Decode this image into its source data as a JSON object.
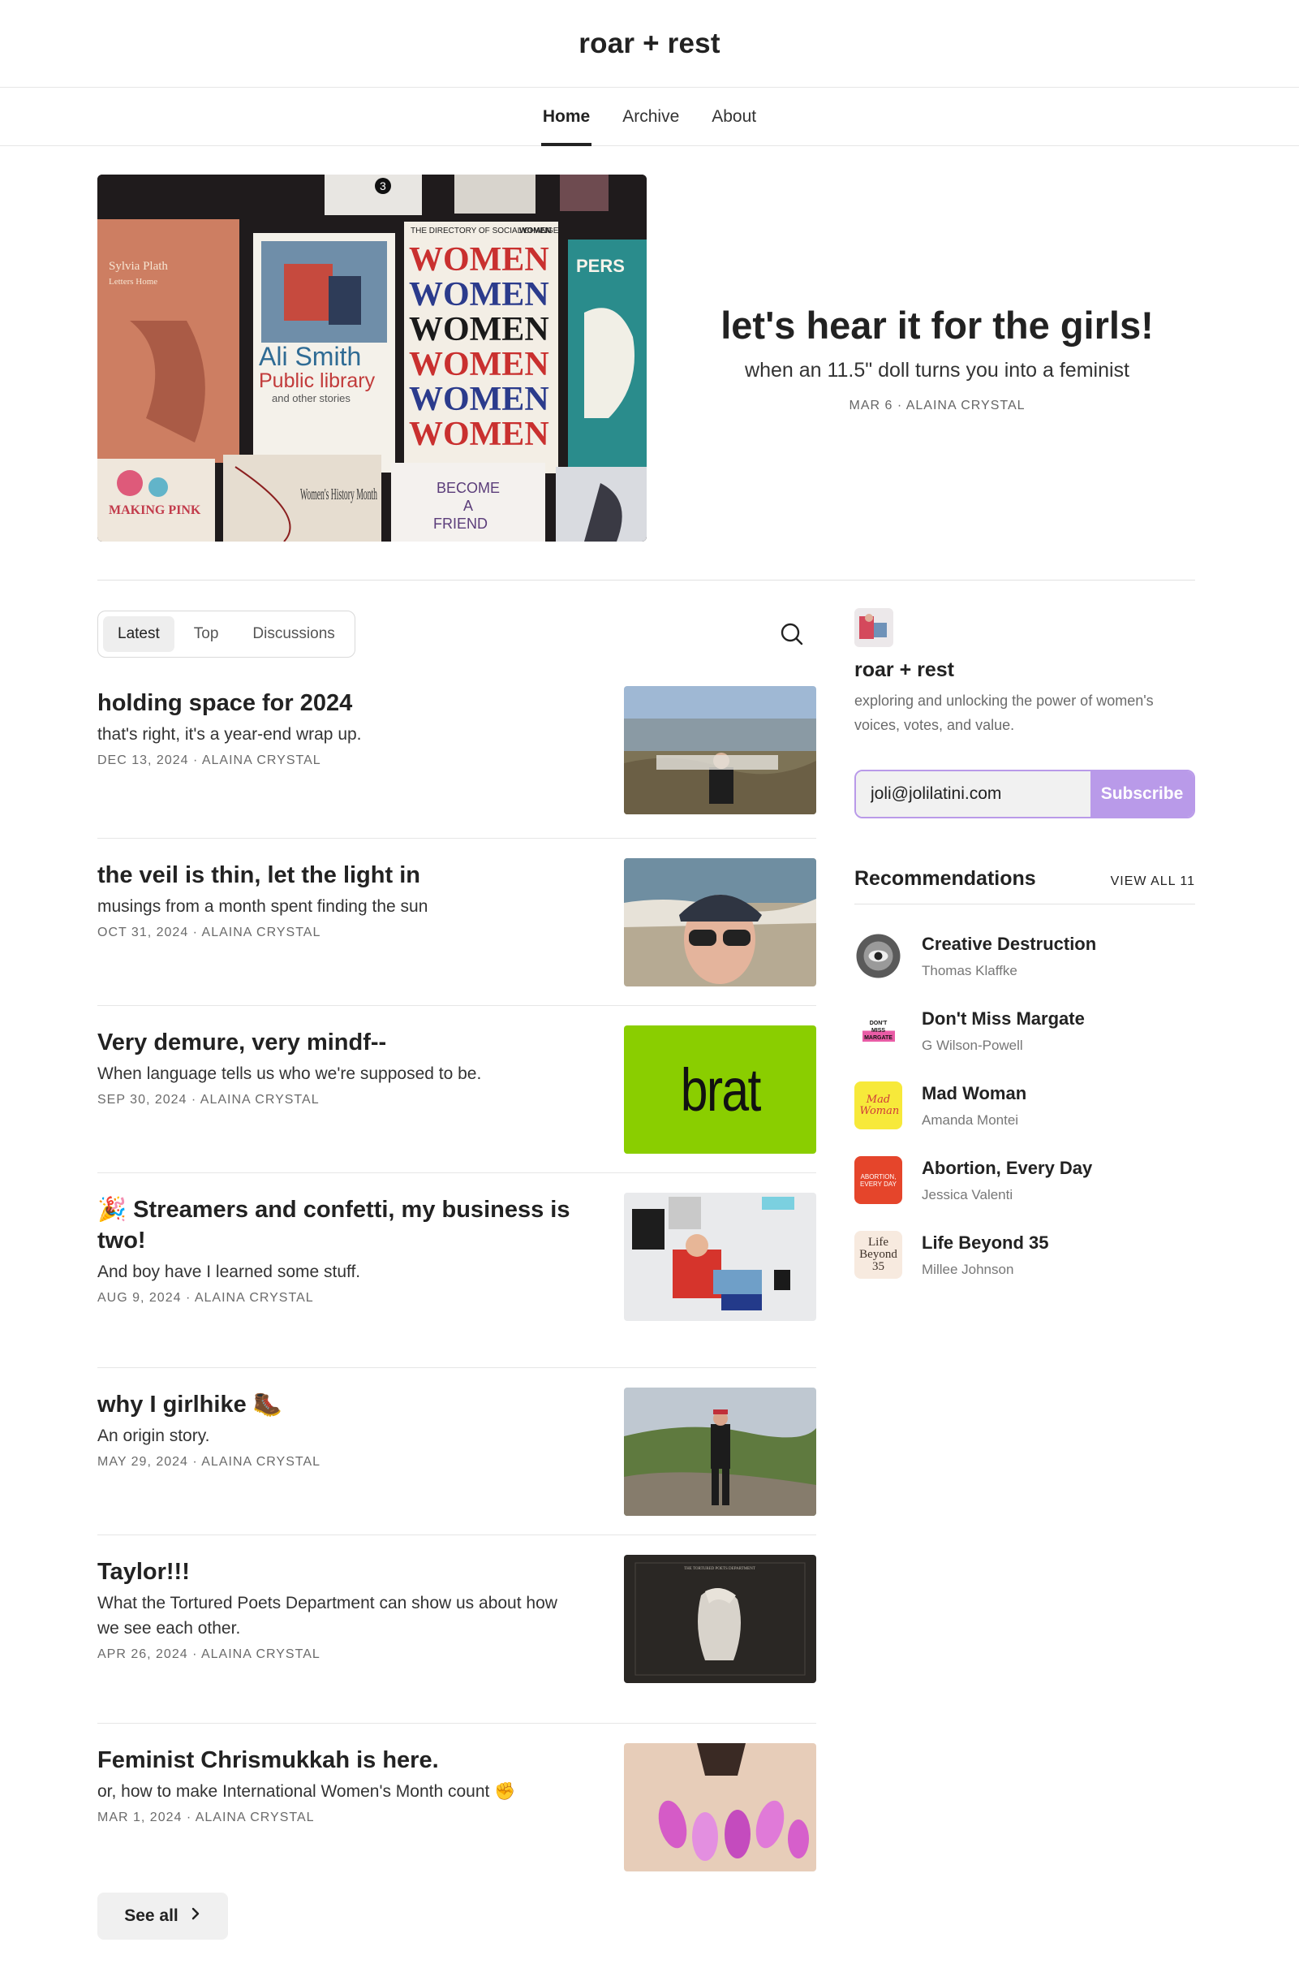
{
  "site": {
    "title": "roar + rest"
  },
  "nav": [
    {
      "label": "Home",
      "active": true
    },
    {
      "label": "Archive",
      "active": false
    },
    {
      "label": "About",
      "active": false
    }
  ],
  "hero": {
    "title": "let's hear it for the girls!",
    "subtitle": "when an 11.5\" doll turns you into a feminist",
    "meta": "MAR 6 · ALAINA CRYSTAL",
    "image_text": {
      "book1_title": "Sylvia Plath",
      "book1_sub": "Letters Home",
      "book2_title": "Ali Smith",
      "book2_sub": "Public library",
      "book2_sub2": "and other stories",
      "book3_header": "THE DIRECTORY OF SOCIAL CHANGE",
      "book3_corner": "WOMEN",
      "book3_word": "WOMEN",
      "book4_top": "PERS",
      "book5": "Women's History Month",
      "book6_top": "BECOME",
      "book6_mid": "A",
      "book6_bottom": "FRIEND",
      "book7": "MAKING PINK",
      "corner_num": "3"
    }
  },
  "tabs": [
    {
      "label": "Latest",
      "active": true
    },
    {
      "label": "Top",
      "active": false
    },
    {
      "label": "Discussions",
      "active": false
    }
  ],
  "posts": [
    {
      "title": "holding space for 2024",
      "subtitle": "that's right, it's a year-end wrap up.",
      "meta": "DEC 13, 2024 · ALAINA CRYSTAL"
    },
    {
      "title": "the veil is thin, let the light in",
      "subtitle": "musings from a month spent finding the sun",
      "meta": "OCT 31, 2024 · ALAINA CRYSTAL"
    },
    {
      "title": "Very demure, very mindf--",
      "subtitle": "When language tells us who we're supposed to be.",
      "meta": "SEP 30, 2024 · ALAINA CRYSTAL",
      "thumb_text": "brat"
    },
    {
      "title": "🎉 Streamers and confetti, my business is two!",
      "subtitle": "And boy have I learned some stuff.",
      "meta": "AUG 9, 2024 · ALAINA CRYSTAL"
    },
    {
      "title": "why I girlhike 🥾",
      "subtitle": "An origin story.",
      "meta": "MAY 29, 2024 · ALAINA CRYSTAL"
    },
    {
      "title": "Taylor!!!",
      "subtitle": "What the Tortured Poets Department can show us about how we see each other.",
      "meta": "APR 26, 2024 · ALAINA CRYSTAL",
      "thumb_text": "THE TORTURED POETS DEPARTMENT"
    },
    {
      "title": "Feminist Chrismukkah is here.",
      "subtitle": "or, how to make International Women's Month count ✊",
      "meta": "MAR 1, 2024 · ALAINA CRYSTAL"
    }
  ],
  "see_all": {
    "label": "See all"
  },
  "sidebar": {
    "name": "roar + rest",
    "description": "exploring and unlocking the power of women's voices, votes, and value.",
    "email_value": "joli@jolilatini.com",
    "subscribe_label": "Subscribe",
    "rec_title": "Recommendations",
    "rec_viewall": "VIEW ALL 11",
    "recommendations": [
      {
        "name": "Creative Destruction",
        "author": "Thomas Klaffke"
      },
      {
        "name": "Don't Miss Margate",
        "author": "G Wilson-Powell",
        "logo_text": "DON'T MISS MARGATE"
      },
      {
        "name": "Mad Woman",
        "author": "Amanda Montei",
        "logo_text": "Mad Woman"
      },
      {
        "name": "Abortion, Every Day",
        "author": "Jessica Valenti",
        "logo_text": "ABORTION, EVERY DAY"
      },
      {
        "name": "Life Beyond 35",
        "author": "Millee Johnson",
        "logo_text": "Life Beyond 35"
      }
    ]
  },
  "colors": {
    "accent": "#b99ae9",
    "text": "#222222",
    "muted": "#6b6b6b",
    "brat_green": "#8ace00"
  }
}
